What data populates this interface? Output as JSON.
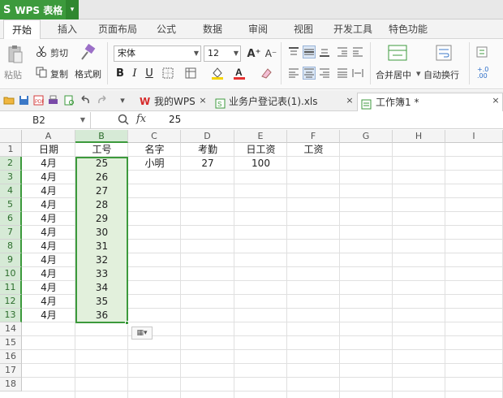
{
  "app": {
    "logo": "S",
    "name": "WPS 表格",
    "dropdown": "▾"
  },
  "menu": {
    "items": [
      "开始",
      "插入",
      "页面布局",
      "公式",
      "数据",
      "审阅",
      "视图",
      "开发工具",
      "特色功能"
    ]
  },
  "ribbon": {
    "paste": "粘贴",
    "cut": "剪切",
    "copy": "复制",
    "format_painter": "格式刷",
    "font_name": "宋体",
    "font_size": "12",
    "bold": "B",
    "italic": "I",
    "underline": "U",
    "grow": "A⁺",
    "shrink": "A⁻",
    "merge_center": "合并居中",
    "wrap": "自动换行",
    "increase_decimal": ".0\n.00",
    "decrease_decimal": ".00\n.0"
  },
  "quickbar": {
    "tabs": [
      {
        "label": "我的WPS",
        "close": "×"
      },
      {
        "label": "业务户登记表(1).xls",
        "close": "×"
      },
      {
        "label": "工作簿1 *",
        "close": "×"
      }
    ]
  },
  "formula": {
    "cell_ref": "B2",
    "fx": "fx",
    "value": "25"
  },
  "columns": [
    "A",
    "B",
    "C",
    "D",
    "E",
    "F",
    "G",
    "H",
    "I"
  ],
  "rows": [
    "1",
    "2",
    "3",
    "4",
    "5",
    "6",
    "7",
    "8",
    "9",
    "10",
    "11",
    "12",
    "13",
    "14",
    "15",
    "16",
    "17",
    "18"
  ],
  "cells": {
    "A1": "日期",
    "B1": "工号",
    "C1": "名字",
    "D1": "考勤",
    "E1": "日工资",
    "F1": "工资",
    "A2": "4月",
    "A3": "4月",
    "A4": "4月",
    "A5": "4月",
    "A6": "4月",
    "A7": "4月",
    "A8": "4月",
    "A9": "4月",
    "A10": "4月",
    "A11": "4月",
    "A12": "4月",
    "A13": "4月",
    "B2": "25",
    "B3": "26",
    "B4": "27",
    "B5": "28",
    "B6": "29",
    "B7": "30",
    "B8": "31",
    "B9": "32",
    "B10": "33",
    "B11": "34",
    "B12": "35",
    "B13": "36",
    "C2": "小明",
    "D2": "27",
    "E2": "100"
  },
  "colors": {
    "accent": "#3c9a3c",
    "selection": "#e2f0dc"
  }
}
